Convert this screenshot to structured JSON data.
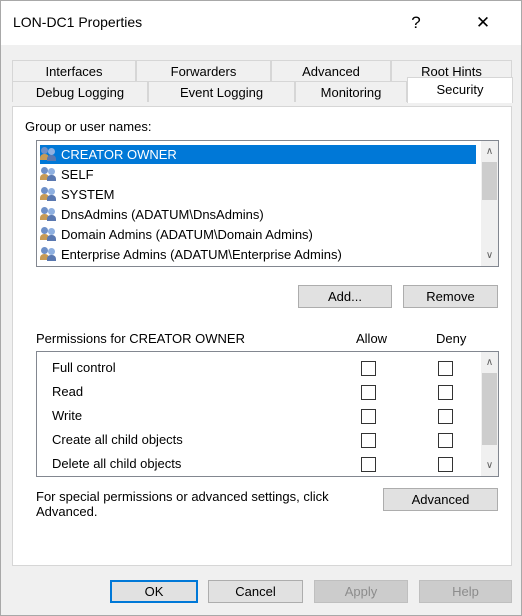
{
  "window": {
    "title": "LON-DC1 Properties",
    "help_label": "?",
    "close_label": "✕"
  },
  "tabs": {
    "row1": [
      "Interfaces",
      "Forwarders",
      "Advanced",
      "Root Hints"
    ],
    "row2": [
      "Debug Logging",
      "Event Logging",
      "Monitoring",
      "Security"
    ],
    "active": "Security"
  },
  "security": {
    "group_label": "Group or user names:",
    "users": [
      {
        "name": "CREATOR OWNER",
        "selected": true
      },
      {
        "name": "SELF"
      },
      {
        "name": "SYSTEM"
      },
      {
        "name": "DnsAdmins (ADATUM\\DnsAdmins)"
      },
      {
        "name": "Domain Admins (ADATUM\\Domain Admins)"
      },
      {
        "name": "Enterprise Admins (ADATUM\\Enterprise Admins)"
      }
    ],
    "add_label": "Add...",
    "remove_label": "Remove",
    "permissions_label": "Permissions for CREATOR OWNER",
    "allow_label": "Allow",
    "deny_label": "Deny",
    "permissions": [
      {
        "name": "Full control",
        "allow": false,
        "deny": false
      },
      {
        "name": "Read",
        "allow": false,
        "deny": false
      },
      {
        "name": "Write",
        "allow": false,
        "deny": false
      },
      {
        "name": "Create all child objects",
        "allow": false,
        "deny": false
      },
      {
        "name": "Delete all child objects",
        "allow": false,
        "deny": false
      }
    ],
    "special_text_1": "For special permissions or advanced settings, click",
    "special_text_2": "Advanced.",
    "advanced_label": "Advanced"
  },
  "footer": {
    "ok": "OK",
    "cancel": "Cancel",
    "apply": "Apply",
    "help": "Help"
  }
}
